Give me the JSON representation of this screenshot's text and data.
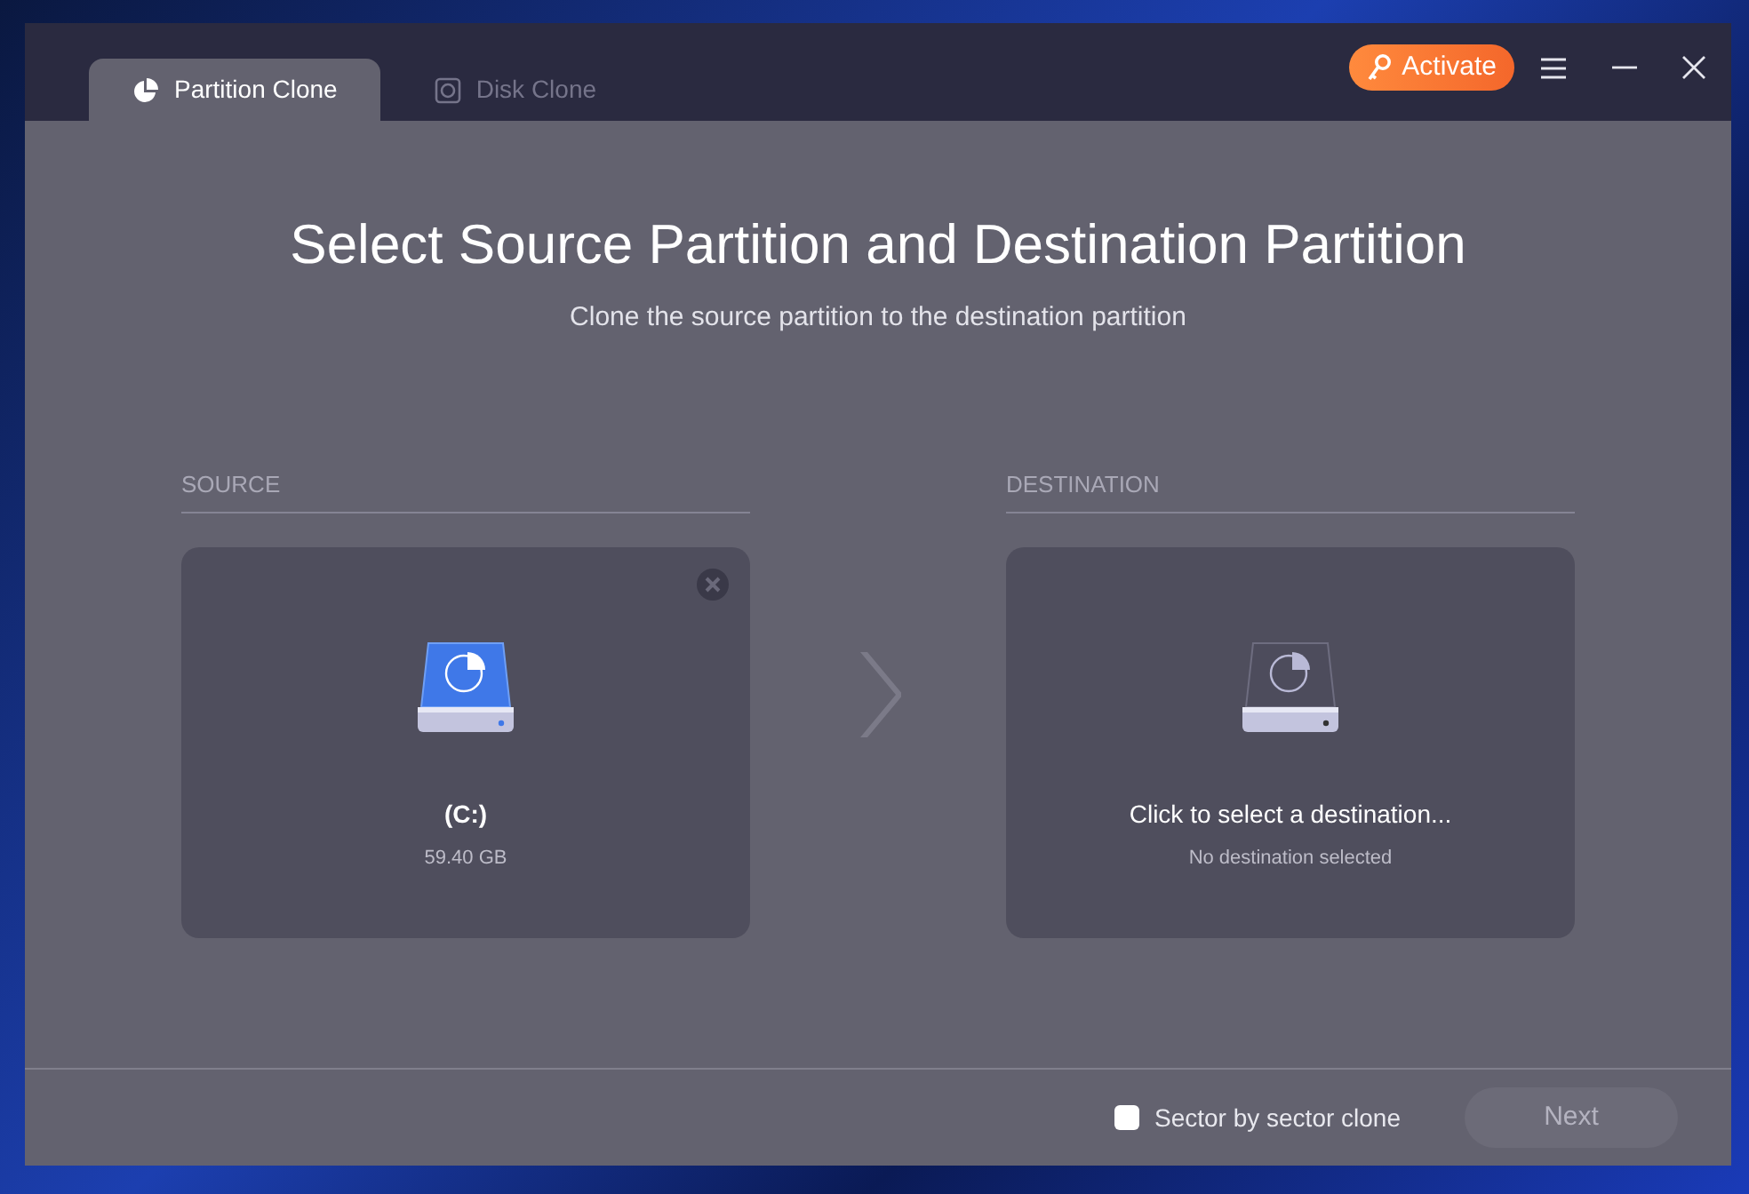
{
  "tabs": [
    {
      "label": "Partition Clone",
      "selected": true
    },
    {
      "label": "Disk Clone",
      "selected": false
    }
  ],
  "activate_button": {
    "label": "Activate"
  },
  "heading": "Select Source Partition and Destination Partition",
  "subheading": "Clone the source partition to the destination partition",
  "source": {
    "label": "SOURCE",
    "title": "(C:)",
    "detail": "59.40 GB",
    "selected": true
  },
  "destination": {
    "label": "DESTINATION",
    "title": "Click to select a destination...",
    "detail": "No destination selected",
    "selected": false
  },
  "sector_by_sector": {
    "label": "Sector by sector clone",
    "checked": false
  },
  "next_button": {
    "label": "Next",
    "disabled": true
  }
}
